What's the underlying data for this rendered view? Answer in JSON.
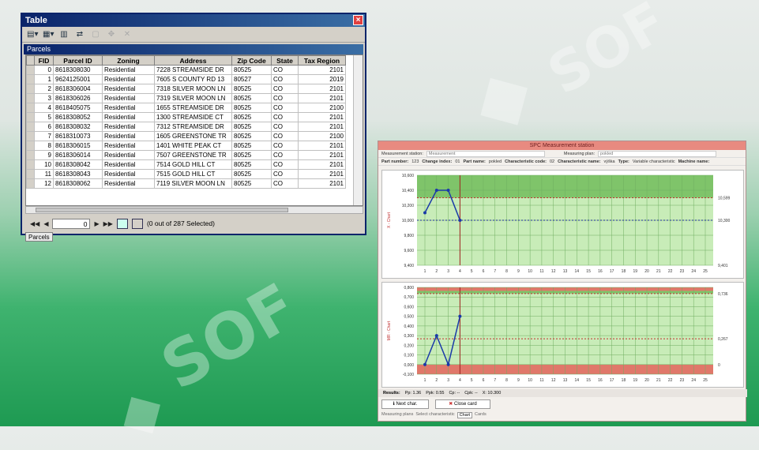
{
  "table_window": {
    "title": "Table",
    "subtitle": "Parcels",
    "columns": [
      "FID",
      "Parcel ID",
      "Zoning",
      "Address",
      "Zip Code",
      "State",
      "Tax Region"
    ],
    "rows": [
      [
        "0",
        "8618308030",
        "Residential",
        "7228 STREAMSIDE DR",
        "80525",
        "CO",
        "2101"
      ],
      [
        "1",
        "9624125001",
        "Residential",
        "7605 S COUNTY RD 13",
        "80527",
        "CO",
        "2019"
      ],
      [
        "2",
        "8618306004",
        "Residential",
        "7318 SILVER MOON LN",
        "80525",
        "CO",
        "2101"
      ],
      [
        "3",
        "8618306026",
        "Residential",
        "7319 SILVER MOON LN",
        "80525",
        "CO",
        "2101"
      ],
      [
        "4",
        "8618405075",
        "Residential",
        "1655 STREAMSIDE DR",
        "80525",
        "CO",
        "2100"
      ],
      [
        "5",
        "8618308052",
        "Residential",
        "1300 STREAMSIDE CT",
        "80525",
        "CO",
        "2101"
      ],
      [
        "6",
        "8618308032",
        "Residential",
        "7312 STREAMSIDE DR",
        "80525",
        "CO",
        "2101"
      ],
      [
        "7",
        "8618310073",
        "Residential",
        "1605 GREENSTONE TR",
        "80525",
        "CO",
        "2100"
      ],
      [
        "8",
        "8618306015",
        "Residential",
        "1401 WHITE PEAK CT",
        "80525",
        "CO",
        "2101"
      ],
      [
        "9",
        "8618306014",
        "Residential",
        "7507 GREENSTONE TR",
        "80525",
        "CO",
        "2101"
      ],
      [
        "10",
        "8618308042",
        "Residential",
        "7514 GOLD HILL CT",
        "80525",
        "CO",
        "2101"
      ],
      [
        "11",
        "8618308043",
        "Residential",
        "7515 GOLD HILL CT",
        "80525",
        "CO",
        "2101"
      ],
      [
        "12",
        "8618308062",
        "Residential",
        "7119 SILVER MOON LN",
        "80525",
        "CO",
        "2101"
      ]
    ],
    "record_index": "0",
    "selection_status": "(0 out of 287 Selected)",
    "bottom_tab": "Parcels"
  },
  "spc_window": {
    "title": "SPC Measurement station",
    "measurement_station_label": "Measurement station:",
    "measurement_station_value": "Measurement",
    "measuring_plan_label": "Measuring plan:",
    "measuring_plan_value": "pokled",
    "part_number_label": "Part number:",
    "part_number_value": "123",
    "change_index_label": "Change index:",
    "change_index_value": "01",
    "part_name_label": "Part name:",
    "part_name_value": "pokled",
    "char_code_label": "Characteristic code:",
    "char_code_value": "02",
    "char_name_label": "Characteristic name:",
    "char_name_value": "výška",
    "type_label": "Type:",
    "type_value": "Variable characteristic",
    "machine_label": "Machine name:",
    "results_label": "Results:",
    "pp": "Pp:  1.36",
    "ppk": "Ppk:  0.55",
    "cp": "Cp:  --",
    "cpk": "Cpk:  --",
    "xbar": "X:  10.300",
    "next_button": "Next char.",
    "close_button": "Close card",
    "tabs": [
      "Measuring plans",
      "Select characteristic",
      "Chart",
      "Cards"
    ],
    "active_tab": "Chart"
  },
  "chart_data": [
    {
      "type": "line",
      "ylabel": "X - Chart",
      "x": [
        1,
        2,
        3,
        4
      ],
      "categories": [
        "1",
        "2",
        "3",
        "4",
        "5",
        "6",
        "7",
        "8",
        "9",
        "10",
        "11",
        "12",
        "13",
        "14",
        "15",
        "16",
        "17",
        "18",
        "19",
        "20",
        "21",
        "22",
        "23",
        "24",
        "25"
      ],
      "values": [
        10.1,
        10.4,
        10.4,
        10.0
      ],
      "ylim": [
        9.4,
        10.6
      ],
      "yticks": [
        "10,600",
        "10,400",
        "10,200",
        "10,000",
        "9,800",
        "9,600",
        "9,400"
      ],
      "ucl": 10.3,
      "center": 10.0,
      "right_labels": [
        "10,599",
        "10,300",
        "9,401"
      ],
      "grid": true
    },
    {
      "type": "line",
      "ylabel": "MR - Chart",
      "x": [
        1,
        2,
        3,
        4
      ],
      "categories": [
        "1",
        "2",
        "3",
        "4",
        "5",
        "6",
        "7",
        "8",
        "9",
        "10",
        "11",
        "12",
        "13",
        "14",
        "15",
        "16",
        "17",
        "18",
        "19",
        "20",
        "21",
        "22",
        "23",
        "24",
        "25"
      ],
      "values": [
        0.0,
        0.3,
        0.0,
        0.5
      ],
      "ylim": [
        -0.1,
        0.8
      ],
      "yticks": [
        "0,800",
        "0,700",
        "0,600",
        "0,500",
        "0,400",
        "0,300",
        "0,200",
        "0,100",
        "0,000",
        "-0,100"
      ],
      "ucl": 0.736,
      "center": 0.267,
      "right_labels": [
        "0,736",
        "0,267",
        "0"
      ],
      "grid": true
    }
  ]
}
